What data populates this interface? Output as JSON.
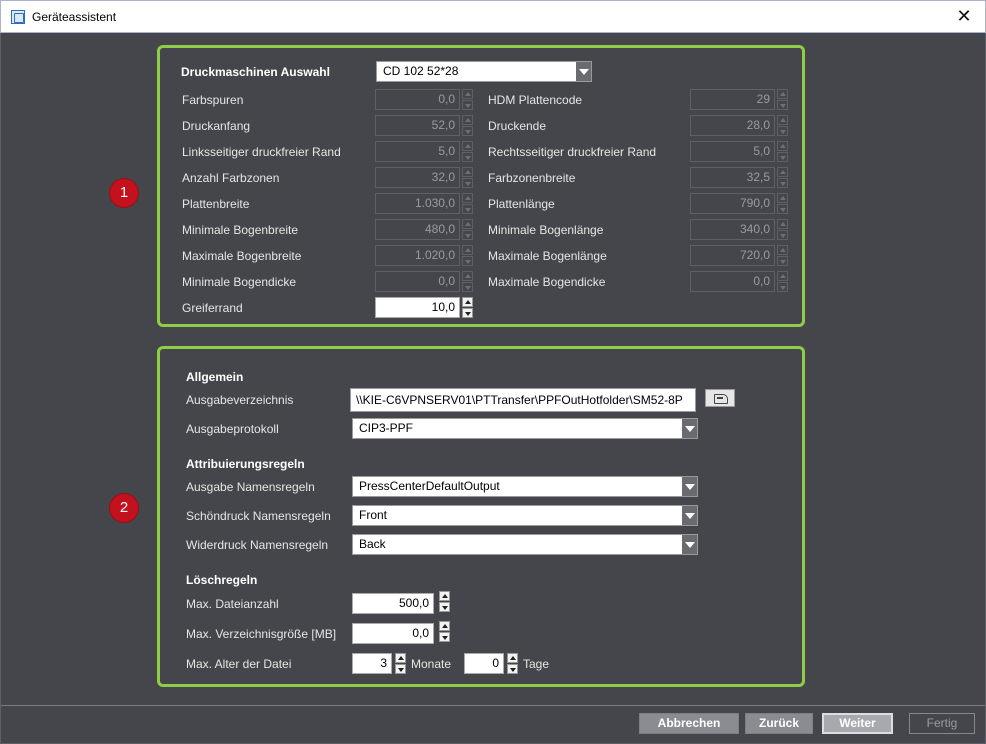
{
  "window": {
    "title": "Geräteassistent"
  },
  "badges": [
    "1",
    "2"
  ],
  "press": {
    "label": "Druckmaschinen Auswahl",
    "value": "CD 102 52*28",
    "left_fields": [
      {
        "label": "Farbspuren",
        "value": "0,0"
      },
      {
        "label": "Druckanfang",
        "value": "52,0"
      },
      {
        "label": "Linksseitiger druckfreier Rand",
        "value": "5,0"
      },
      {
        "label": "Anzahl Farbzonen",
        "value": "32,0"
      },
      {
        "label": "Plattenbreite",
        "value": "1.030,0"
      },
      {
        "label": "Minimale Bogenbreite",
        "value": "480,0"
      },
      {
        "label": "Maximale Bogenbreite",
        "value": "1.020,0"
      },
      {
        "label": "Minimale Bogendicke",
        "value": "0,0"
      },
      {
        "label": "Greiferrand",
        "value": "10,0"
      }
    ],
    "right_fields": [
      {
        "label": "HDM Plattencode",
        "value": "29"
      },
      {
        "label": "Druckende",
        "value": "28,0"
      },
      {
        "label": "Rechtsseitiger druckfreier Rand",
        "value": "5,0"
      },
      {
        "label": "Farbzonenbreite",
        "value": "32,5"
      },
      {
        "label": "Plattenlänge",
        "value": "790,0"
      },
      {
        "label": "Minimale Bogenlänge",
        "value": "340,0"
      },
      {
        "label": "Maximale Bogenlänge",
        "value": "720,0"
      },
      {
        "label": "Maximale Bogendicke",
        "value": "0,0"
      }
    ]
  },
  "general": {
    "heading": "Allgemein",
    "output_dir_label": "Ausgabeverzeichnis",
    "output_dir_value": "\\\\KIE-C6VPNSERV01\\PTTransfer\\PPFOutHotfolder\\SM52-8P",
    "protocol_label": "Ausgabeprotokoll",
    "protocol_value": "CIP3-PPF"
  },
  "attribution": {
    "heading": "Attribuierungsregeln",
    "rules": [
      {
        "label": "Ausgabe Namensregeln",
        "value": "PressCenterDefaultOutput"
      },
      {
        "label": "Schöndruck Namensregeln",
        "value": "Front"
      },
      {
        "label": "Widerdruck Namensregeln",
        "value": "Back"
      }
    ]
  },
  "deletion": {
    "heading": "Löschregeln",
    "max_files_label": "Max. Dateianzahl",
    "max_files_value": "500,0",
    "max_dir_label": "Max. Verzeichnisgröße [MB]",
    "max_dir_value": "0,0",
    "max_age_label": "Max. Alter der Datei",
    "months_value": "3",
    "months_unit": "Monate",
    "days_value": "0",
    "days_unit": "Tage"
  },
  "buttons": {
    "cancel": "Abbrechen",
    "back": "Zurück",
    "next": "Weiter",
    "finish": "Fertig"
  }
}
